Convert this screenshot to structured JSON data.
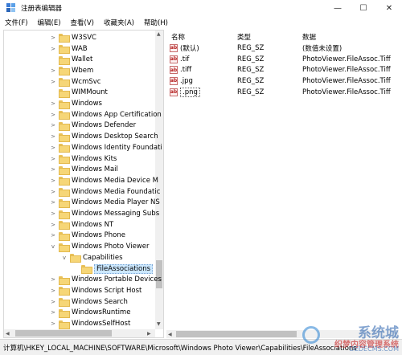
{
  "window": {
    "title": "注册表编辑器",
    "controls": {
      "minimize": "—",
      "maximize": "☐",
      "close": "✕"
    }
  },
  "menu": [
    "文件(F)",
    "编辑(E)",
    "查看(V)",
    "收藏夹(A)",
    "帮助(H)"
  ],
  "tree": [
    {
      "label": "W3SVC",
      "level": 2,
      "expander": ">"
    },
    {
      "label": "WAB",
      "level": 2,
      "expander": ">"
    },
    {
      "label": "Wallet",
      "level": 2,
      "expander": ""
    },
    {
      "label": "Wbem",
      "level": 2,
      "expander": ">"
    },
    {
      "label": "WcmSvc",
      "level": 2,
      "expander": ">"
    },
    {
      "label": "WIMMount",
      "level": 2,
      "expander": ""
    },
    {
      "label": "Windows",
      "level": 2,
      "expander": ">"
    },
    {
      "label": "Windows App Certification",
      "level": 2,
      "expander": ">"
    },
    {
      "label": "Windows Defender",
      "level": 2,
      "expander": ">"
    },
    {
      "label": "Windows Desktop Search",
      "level": 2,
      "expander": ">"
    },
    {
      "label": "Windows Identity Foundati",
      "level": 2,
      "expander": ">"
    },
    {
      "label": "Windows Kits",
      "level": 2,
      "expander": ">"
    },
    {
      "label": "Windows Mail",
      "level": 2,
      "expander": ">"
    },
    {
      "label": "Windows Media Device M",
      "level": 2,
      "expander": ">"
    },
    {
      "label": "Windows Media Foundatic",
      "level": 2,
      "expander": ">"
    },
    {
      "label": "Windows Media Player NS",
      "level": 2,
      "expander": ">"
    },
    {
      "label": "Windows Messaging Subs",
      "level": 2,
      "expander": ">"
    },
    {
      "label": "Windows NT",
      "level": 2,
      "expander": ">"
    },
    {
      "label": "Windows Phone",
      "level": 2,
      "expander": ">"
    },
    {
      "label": "Windows Photo Viewer",
      "level": 2,
      "expander": "v"
    },
    {
      "label": "Capabilities",
      "level": 3,
      "expander": "v"
    },
    {
      "label": "FileAssociations",
      "level": 4,
      "expander": "",
      "selected": true
    },
    {
      "label": "Windows Portable Devices",
      "level": 2,
      "expander": ">"
    },
    {
      "label": "Windows Script Host",
      "level": 2,
      "expander": ">"
    },
    {
      "label": "Windows Search",
      "level": 2,
      "expander": ">"
    },
    {
      "label": "WindowsRuntime",
      "level": 2,
      "expander": ">"
    },
    {
      "label": "WindowsSelfHost",
      "level": 2,
      "expander": ">"
    }
  ],
  "values": {
    "columns": {
      "name": "名称",
      "type": "类型",
      "data": "数据"
    },
    "rows": [
      {
        "name": "(默认)",
        "type": "REG_SZ",
        "data": "(数值未设置)"
      },
      {
        "name": ".tif",
        "type": "REG_SZ",
        "data": "PhotoViewer.FileAssoc.Tiff"
      },
      {
        "name": ".tiff",
        "type": "REG_SZ",
        "data": "PhotoViewer.FileAssoc.Tiff"
      },
      {
        "name": ".jpg",
        "type": "REG_SZ",
        "data": "PhotoViewer.FileAssoc.Tiff"
      },
      {
        "name": ".png",
        "type": "REG_SZ",
        "data": "PhotoViewer.FileAssoc.Tiff",
        "focused": true
      }
    ],
    "icon": "ab"
  },
  "status": {
    "path": "计算机\\HKEY_LOCAL_MACHINE\\SOFTWARE\\Microsoft\\Windows Photo Viewer\\Capabilities\\FileAssociations"
  },
  "watermark": {
    "main": "系统城",
    "sub": "织梦内容管理系统",
    "url": "DEDECMS.COM"
  },
  "icons": {
    "app": "registry-editor-icon",
    "folder": "folder-icon",
    "value": "string-value-icon"
  },
  "colors": {
    "selection": "#cce8ff",
    "folder": "#f6d677",
    "watermark": "#1e5aaa"
  }
}
